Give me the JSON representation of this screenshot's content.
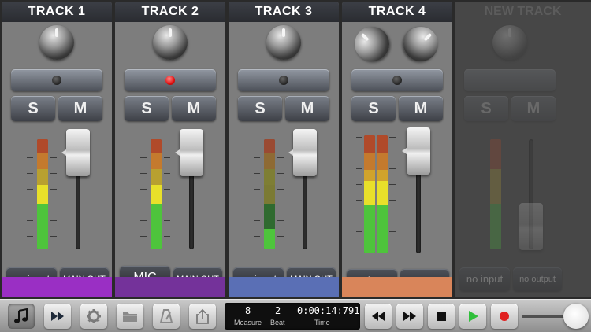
{
  "tracks": [
    {
      "title": "TRACK 1",
      "solo_label": "S",
      "mute_label": "M",
      "input_label": "no input",
      "output_label": "MAIN OUT",
      "armed": false,
      "footer_color": "#9a2fc4"
    },
    {
      "title": "TRACK 2",
      "solo_label": "S",
      "mute_label": "M",
      "input_label": "MIC",
      "output_label": "MAIN OUT",
      "armed": true,
      "footer_color": "#74329a"
    },
    {
      "title": "TRACK 3",
      "solo_label": "S",
      "mute_label": "M",
      "input_label": "no input",
      "output_label": "MAIN OUT",
      "armed": false,
      "footer_color": "#5a6fb5"
    },
    {
      "title": "TRACK 4",
      "solo_label": "S",
      "mute_label": "M",
      "input_label": "no input",
      "output_label": "MAIN OUT",
      "armed": false,
      "footer_color": "#d9855a"
    }
  ],
  "new_track": {
    "title": "NEW TRACK",
    "solo_label": "S",
    "mute_label": "M",
    "input_label": "no input",
    "output_label": "no output"
  },
  "transport": {
    "measure": "8",
    "beat": "2",
    "time": "0:00:14:791",
    "measure_label": "Measure",
    "beat_label": "Beat",
    "time_label": "Time"
  },
  "toolbar_icons": [
    "music-note-icon",
    "fast-forward-icon",
    "gear-icon",
    "folder-icon",
    "metronome-icon",
    "share-icon"
  ],
  "colors": {
    "play": "#2fbf3a",
    "record": "#e02020",
    "meter_green": "#4ec43c",
    "meter_yellow": "#e8e02a",
    "meter_orange": "#d89a2a",
    "meter_red": "#c0502a"
  }
}
